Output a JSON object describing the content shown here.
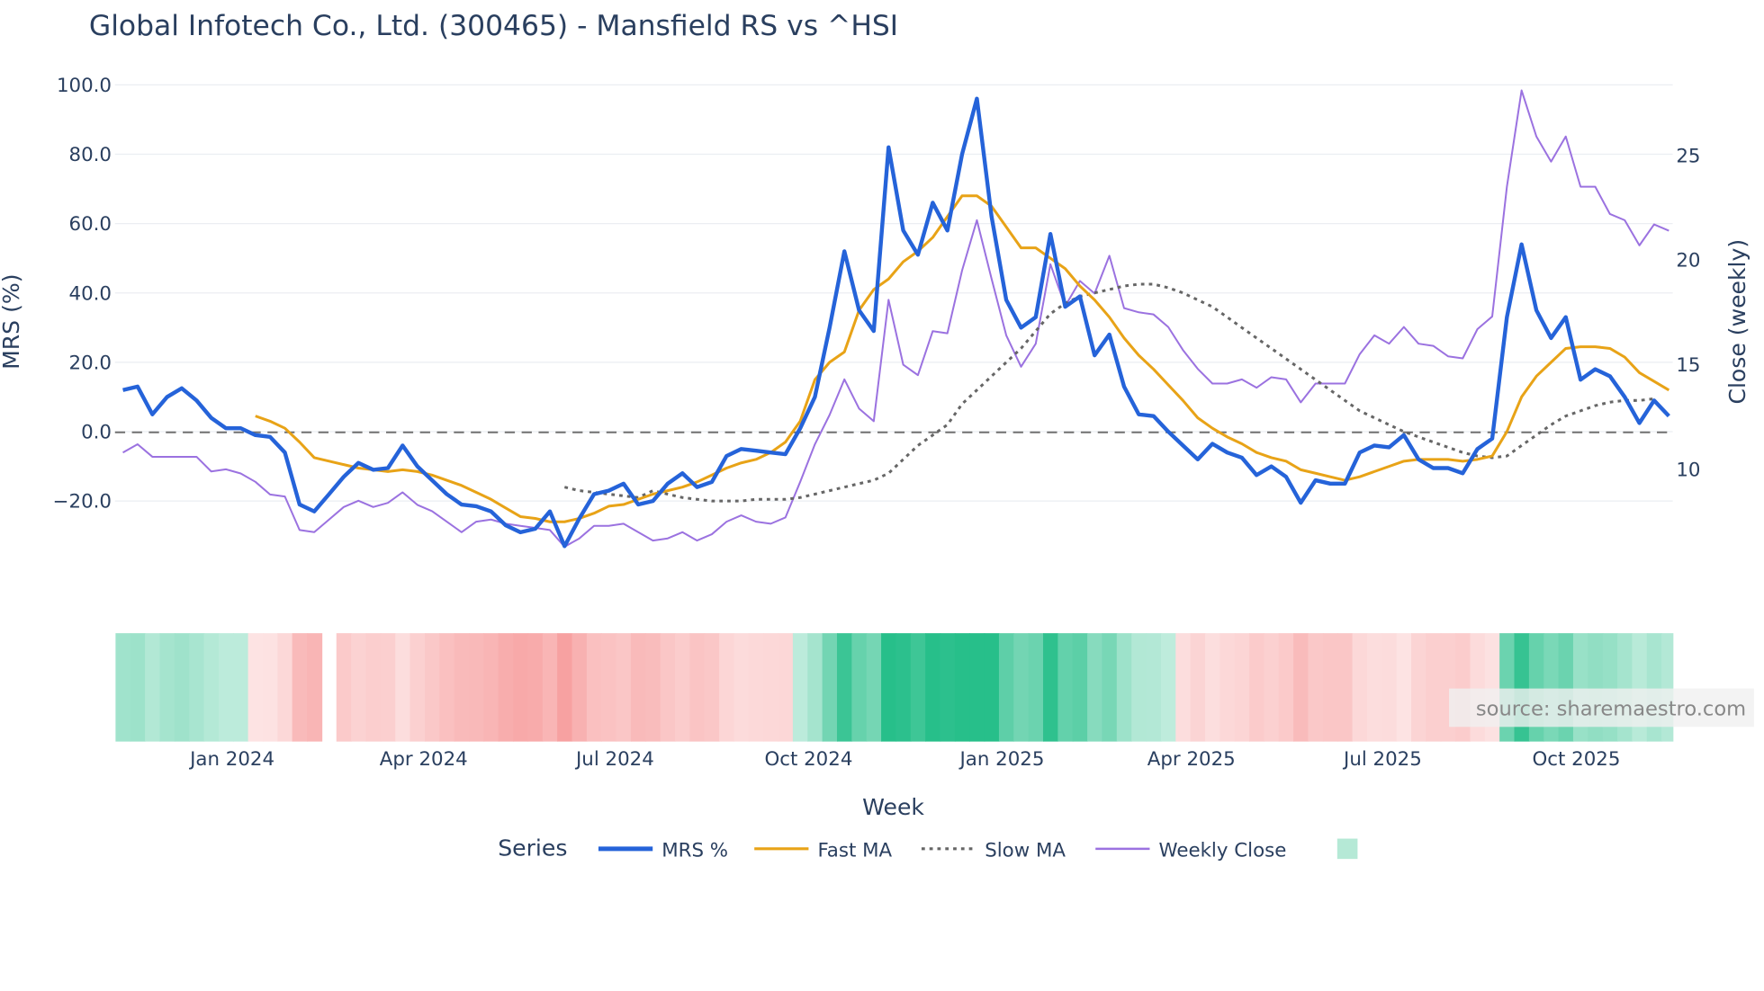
{
  "chart_data": {
    "type": "line",
    "title": "Global Infotech Co., Ltd. (300465) - Mansfield RS vs ^HSI",
    "xlabel": "Week",
    "ylabel": "MRS (%)",
    "y2label": "Close (weekly)",
    "x_start_week": "2023-11-10",
    "x_step_days": 7,
    "x_ticks": [
      "Jan 2024",
      "Apr 2024",
      "Jul 2024",
      "Oct 2024",
      "Jan 2025",
      "Apr 2025",
      "Jul 2025",
      "Oct 2025"
    ],
    "x_tick_dates": [
      "2024-01-01",
      "2024-04-01",
      "2024-07-01",
      "2024-10-01",
      "2025-01-01",
      "2025-04-01",
      "2025-07-01",
      "2025-10-01"
    ],
    "y_ticks": [
      "100.0",
      "80.0",
      "60.0",
      "40.0",
      "20.0",
      "0.0",
      "−20.0"
    ],
    "y_tick_values": [
      100,
      80,
      60,
      40,
      20,
      0,
      -20
    ],
    "y2_ticks": [
      "25",
      "20",
      "15",
      "10"
    ],
    "y2_tick_values": [
      25,
      20,
      15,
      10
    ],
    "ylim": [
      -35,
      102
    ],
    "y2lim": [
      6,
      28.7
    ],
    "grid": true,
    "reference_line": 0,
    "legend_title": "Series",
    "legend_position": "bottom",
    "series": [
      {
        "name": "MRS %",
        "axis": "left",
        "color": "#2563d9",
        "start_index": 0,
        "values": [
          12,
          13,
          5,
          10,
          12.5,
          9,
          4,
          1,
          1,
          -1,
          -1.5,
          -6,
          -21,
          -23,
          -18,
          -13,
          -9,
          -11,
          -10.5,
          -4,
          -10,
          -14,
          -18,
          -21,
          -21.5,
          -23,
          -27,
          -29,
          -28,
          -23,
          -33,
          -25,
          -18,
          -17,
          -15,
          -21,
          -20,
          -15,
          -12,
          -16,
          -14.5,
          -7,
          -5,
          -5.5,
          -6,
          -6.5,
          1,
          10,
          30,
          52,
          35,
          29,
          82,
          58,
          51,
          66,
          58,
          80,
          96,
          62,
          38,
          30,
          33,
          57,
          36,
          39,
          22,
          28,
          13,
          5,
          4.5,
          0,
          -4,
          -8,
          -3.5,
          -6,
          -7.5,
          -12.5,
          -10,
          -13,
          -20.5,
          -14,
          -15,
          -15,
          -6,
          -4,
          -4.5,
          -1,
          -8,
          -10.5,
          -10.5,
          -12,
          -5,
          -2,
          33,
          54,
          35,
          27,
          33,
          15,
          18,
          16,
          10,
          2.5,
          9,
          4.5
        ]
      },
      {
        "name": "Fast MA",
        "axis": "left",
        "color": "#e8a317",
        "start_index": 9,
        "values": [
          4.5,
          3,
          1,
          -3,
          -7.5,
          -8.5,
          -9.5,
          -10.5,
          -11,
          -11.5,
          -11,
          -11.5,
          -12.5,
          -14,
          -15.5,
          -17.5,
          -19.5,
          -22,
          -24.5,
          -25,
          -26,
          -26,
          -25,
          -23.5,
          -21.5,
          -21,
          -19.5,
          -18,
          -17,
          -16,
          -14.5,
          -12.5,
          -10.5,
          -9,
          -8,
          -6,
          -3,
          3,
          15,
          20,
          23,
          35,
          41,
          44,
          49,
          52,
          56,
          62,
          68,
          68,
          65,
          59,
          53,
          53,
          50,
          47,
          42,
          38,
          33,
          27,
          22,
          18,
          13.5,
          9,
          4,
          1,
          -1.5,
          -3.5,
          -6,
          -7.5,
          -8.5,
          -11,
          -12,
          -13,
          -14,
          -13,
          -11.5,
          -10,
          -8.5,
          -8,
          -8,
          -8,
          -8.5,
          -8,
          -7,
          0,
          10,
          16,
          20,
          24,
          24.5,
          24.5,
          24,
          21.5,
          17,
          14.5,
          12
        ]
      },
      {
        "name": "Slow MA",
        "axis": "left",
        "color": "#666666",
        "dash": true,
        "start_index": 30,
        "values": [
          -16,
          -17,
          -17.5,
          -18,
          -18.5,
          -19,
          -17,
          -18,
          -19,
          -19.5,
          -20,
          -20,
          -20,
          -19.5,
          -19.5,
          -19.5,
          -19,
          -18,
          -17,
          -16,
          -15,
          -14,
          -12,
          -8,
          -4,
          -1,
          2,
          8,
          12,
          16,
          20,
          24,
          29,
          34,
          37,
          39,
          40,
          41,
          42,
          42.5,
          42.5,
          41.5,
          40,
          38,
          36,
          33,
          30,
          27,
          24,
          21,
          18,
          15,
          12,
          9,
          6,
          4,
          2,
          0,
          -1.5,
          -3,
          -4.5,
          -6,
          -7,
          -7.5,
          -7,
          -4,
          -1,
          2,
          4.5,
          6,
          7.5,
          8.5,
          9,
          9,
          9.5
        ]
      },
      {
        "name": "Weekly Close",
        "axis": "right",
        "color": "#9b72e0",
        "start_index": 0,
        "values": [
          10.8,
          11.2,
          10.6,
          10.6,
          10.6,
          10.6,
          9.9,
          10.0,
          9.8,
          9.4,
          8.8,
          8.7,
          7.1,
          7.0,
          7.6,
          8.2,
          8.5,
          8.2,
          8.4,
          8.9,
          8.3,
          8.0,
          7.5,
          7.0,
          7.5,
          7.6,
          7.4,
          7.3,
          7.2,
          7.1,
          6.3,
          6.7,
          7.3,
          7.3,
          7.4,
          7.0,
          6.6,
          6.7,
          7.0,
          6.6,
          6.9,
          7.5,
          7.8,
          7.5,
          7.4,
          7.7,
          9.4,
          11.2,
          12.6,
          14.3,
          12.9,
          12.3,
          18.1,
          15.0,
          14.5,
          16.6,
          16.5,
          19.5,
          21.9,
          19.1,
          16.4,
          14.9,
          16.0,
          19.8,
          17.8,
          19.0,
          18.4,
          20.2,
          17.7,
          17.5,
          17.4,
          16.8,
          15.7,
          14.8,
          14.1,
          14.1,
          14.3,
          13.9,
          14.4,
          14.3,
          13.2,
          14.1,
          14.1,
          14.1,
          15.5,
          16.4,
          16.0,
          16.8,
          16.0,
          15.9,
          15.4,
          15.3,
          16.7,
          17.3,
          23.5,
          28.1,
          25.9,
          24.7,
          25.9,
          23.5,
          23.5,
          22.2,
          21.9,
          20.7,
          21.7,
          21.4
        ]
      }
    ],
    "heatmap": {
      "source_series": "MRS %",
      "missing_index": 14,
      "positive_color": "#27bf8a",
      "negative_color": "#f47c7c"
    }
  },
  "source_label": "source: sharemaestro.com"
}
